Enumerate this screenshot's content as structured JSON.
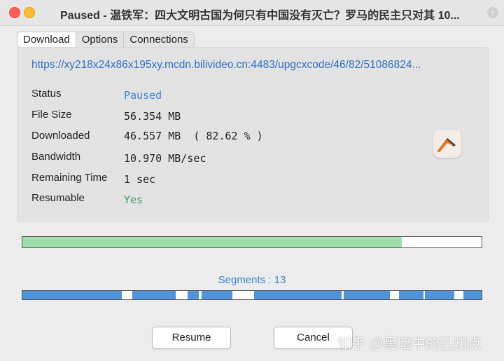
{
  "window": {
    "state": "Paused",
    "title_separator": " - ",
    "title": "温铁军：四大文明古国为何只有中国没有灭亡？罗马的民主只对其 10..."
  },
  "tabs": [
    {
      "label": "Download",
      "active": true
    },
    {
      "label": "Options",
      "active": false
    },
    {
      "label": "Connections",
      "active": false
    }
  ],
  "url": "https://xy218x24x86x195xy.mcdn.bilivideo.cn:4483/upgcxcode/46/82/51086824...",
  "details": [
    {
      "label": "Status",
      "value": "Paused"
    },
    {
      "label": "File Size",
      "value": "56.354 MB"
    },
    {
      "label": "Downloaded",
      "value": "46.557 MB  ( 82.62 % )"
    },
    {
      "label": "Bandwidth",
      "value": "10.970 MB/sec"
    },
    {
      "label": "Remaining Time",
      "value": "1 sec"
    },
    {
      "label": "Resumable",
      "value": "Yes"
    }
  ],
  "progress": {
    "fraction": 0.8262
  },
  "segments": {
    "label": "Segments : 13",
    "count": 13
  },
  "buttons": {
    "resume": "Resume",
    "cancel": "Cancel"
  },
  "watermark": "知乎 @黑暗中的已知点",
  "colors": {
    "accent": "#3a7fd5",
    "progress": "#9ddfa9",
    "segment": "#4e93dd",
    "status_green": "#3d9b4e"
  },
  "icons": {
    "app": "downloader-app-icon",
    "scroll_up": "arrow-up-icon"
  }
}
